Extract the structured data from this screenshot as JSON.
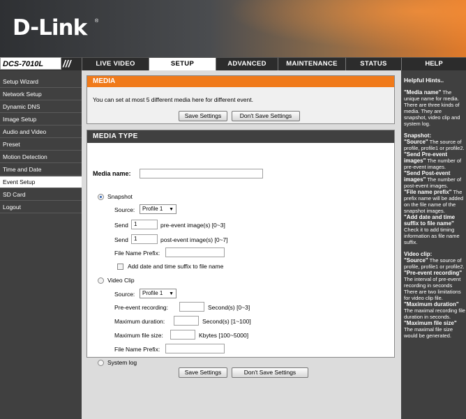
{
  "brand": {
    "logo": "D-Link",
    "reg": "®",
    "model": "DCS-7010L",
    "slashes": "///"
  },
  "tabs": [
    "LIVE VIDEO",
    "SETUP",
    "ADVANCED",
    "MAINTENANCE",
    "STATUS",
    "HELP"
  ],
  "active_tab": "SETUP",
  "sidebar": {
    "items": [
      "Setup Wizard",
      "Network Setup",
      "Dynamic DNS",
      "Image Setup",
      "Audio and Video",
      "Preset",
      "Motion Detection",
      "Time and Date",
      "Event Setup",
      "SD Card",
      "Logout"
    ],
    "active": "Event Setup"
  },
  "media": {
    "title": "MEDIA",
    "info": "You can set at most 5 different media here for different event.",
    "save_label": "Save Settings",
    "dont_save_label": "Don't Save Settings"
  },
  "media_type": {
    "title": "MEDIA TYPE",
    "media_name_label": "Media name:",
    "media_name_value": "",
    "snapshot": {
      "label": "Snapshot",
      "selected": true,
      "source_label": "Source:",
      "source_value": "Profile 1",
      "send_label": "Send",
      "pre_value": "1",
      "pre_suffix": "pre-event image(s) [0~3]",
      "post_value": "1",
      "post_suffix": "post-event image(s) [0~7]",
      "prefix_label": "File Name Prefix:",
      "prefix_value": "",
      "suffix_label": "Add date and time suffix to file name",
      "suffix_checked": false
    },
    "video": {
      "label": "Video Clip",
      "selected": false,
      "source_label": "Source:",
      "source_value": "Profile 1",
      "pre_label": "Pre-event recording:",
      "pre_unit": "Second(s) [0~3]",
      "max_dur_label": "Maximum duration:",
      "max_dur_unit": "Second(s) [1~100]",
      "max_size_label": "Maximum file size:",
      "max_size_unit": "Kbytes [100~5000]",
      "prefix_label": "File Name Prefix:"
    },
    "syslog": {
      "label": "System log",
      "selected": false
    }
  },
  "help": {
    "title": "Helpful Hints..",
    "lines": [
      {
        "b": "\"Media name\"",
        "t": " The unique name for media. There are three kinds of media. They are snapshot, video clip and system log."
      },
      {
        "b": "Snapshot:",
        "t": ""
      },
      {
        "b": "\"Source\"",
        "t": " The source of profile, profile1 or profile2."
      },
      {
        "b": "\"Send Pre-event images\"",
        "t": " The number of pre-event images."
      },
      {
        "b": "\"Send Post-event images\"",
        "t": " The number of post-event images."
      },
      {
        "b": "\"File name prefix\"",
        "t": " The prefix name will be added on the file name of the snapshot images."
      },
      {
        "b": "\"Add date and time suffix to file name\"",
        "t": " Check it to add timing information as file name suffix."
      },
      {
        "b": "Video clip:",
        "t": ""
      },
      {
        "b": "\"Source\"",
        "t": " The source of profile, profile1 or profile2."
      },
      {
        "b": "\"Pre-event recording\"",
        "t": " The interval of pre-event recording in seconds There are two limitations for video clip file."
      },
      {
        "b": "\"Maximum duration\"",
        "t": " The maximal recording file duration in seconds."
      },
      {
        "b": "\"Maximum file size\"",
        "t": " The maximal file size would be generated."
      }
    ]
  }
}
